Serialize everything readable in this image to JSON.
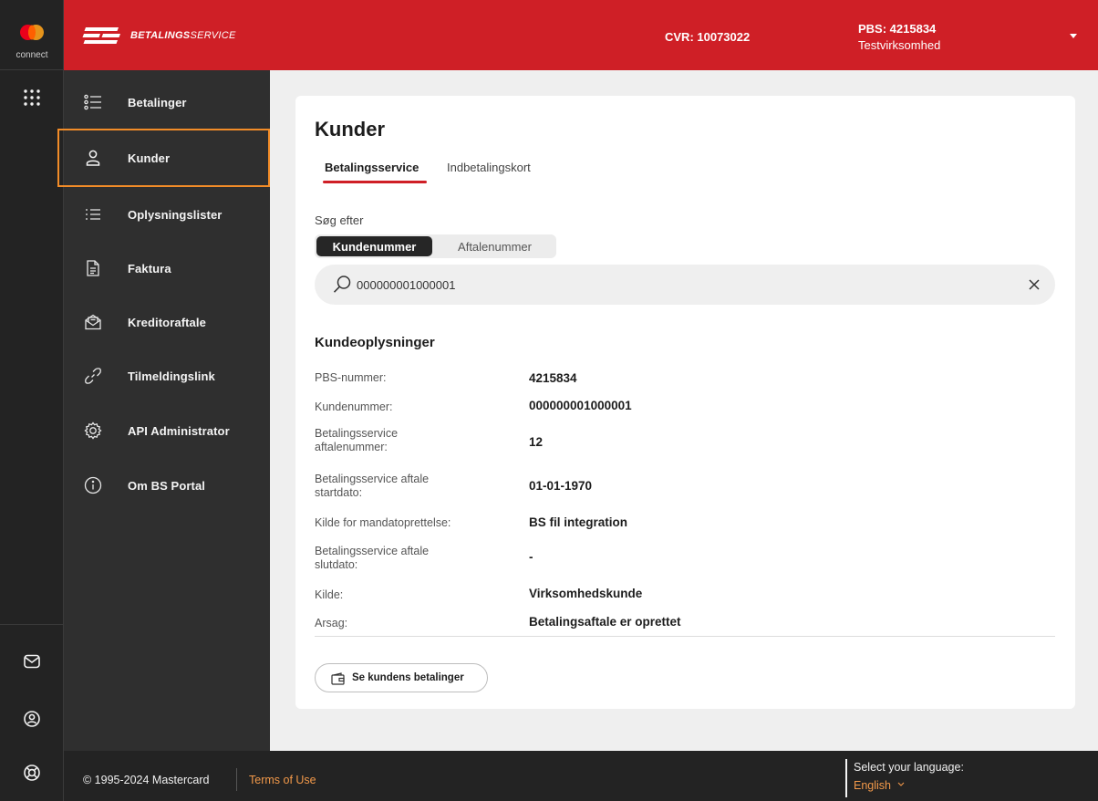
{
  "rail": {
    "brand_label": "connect"
  },
  "header": {
    "brand_bold": "BETALINGS",
    "brand_thin": "SERVICE",
    "cvr": "CVR: 10073022",
    "pbs": "PBS: 4215834",
    "company": "Testvirksomhed"
  },
  "sidebar": {
    "items": [
      {
        "label": "Betalinger",
        "icon": "list-icon"
      },
      {
        "label": "Kunder",
        "icon": "person-icon",
        "active": true
      },
      {
        "label": "Oplysningslister",
        "icon": "bullet-list-icon"
      },
      {
        "label": "Faktura",
        "icon": "document-icon"
      },
      {
        "label": "Kreditoraftale",
        "icon": "envelope-document-icon"
      },
      {
        "label": "Tilmeldingslink",
        "icon": "link-icon"
      },
      {
        "label": "API Administrator",
        "icon": "gear-icon"
      },
      {
        "label": "Om BS Portal",
        "icon": "info-icon"
      }
    ]
  },
  "main": {
    "title": "Kunder",
    "tabs": [
      {
        "label": "Betalingsservice",
        "active": true
      },
      {
        "label": "Indbetalingskort",
        "active": false
      }
    ],
    "search_label": "Søg efter",
    "segments": [
      {
        "label": "Kundenummer",
        "active": true
      },
      {
        "label": "Aftalenummer",
        "active": false
      }
    ],
    "search_value": "000000001000001",
    "section_title": "Kundeoplysninger",
    "info_rows": [
      {
        "label": "PBS-nummer:",
        "value": "4215834"
      },
      {
        "label": "Kundenummer:",
        "value": "000000001000001"
      },
      {
        "label": "Betalingsservice aftalenummer:",
        "value": "12"
      },
      {
        "label": "Betalingsservice aftale startdato:",
        "value": "01-01-1970"
      },
      {
        "label": "Kilde for mandatoprettelse:",
        "value": "BS fil integration"
      },
      {
        "label": "Betalingsservice aftale slutdato:",
        "value": "-"
      },
      {
        "label": "Kilde:",
        "value": "Virksomhedskunde"
      },
      {
        "label": "Arsag:",
        "value": "Betalingsaftale er oprettet"
      }
    ],
    "action_button": "Se kundens betalinger"
  },
  "footer": {
    "copyright": "© 1995-2024 Mastercard",
    "terms": "Terms of Use",
    "language_label": "Select your language:",
    "language_value": "English"
  },
  "colors": {
    "brand_red": "#cf1f26",
    "accent_orange": "#f28c28",
    "dark": "#232323",
    "sidebar": "#2f2f2f"
  }
}
